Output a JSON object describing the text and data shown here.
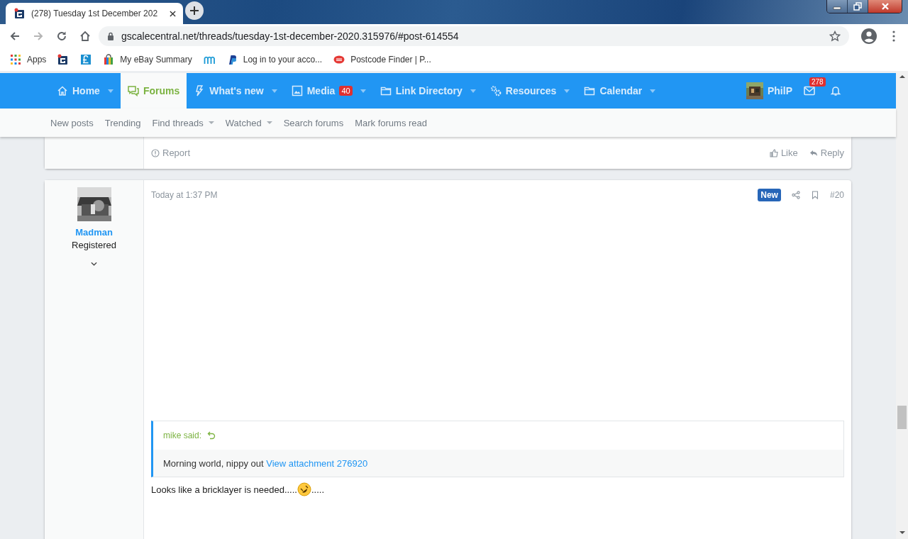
{
  "browser": {
    "tab_title": "(278) Tuesday 1st December 202",
    "url": "gscalecentral.net/threads/tuesday-1st-december-2020.315976/#post-614554",
    "bookmarks": [
      {
        "kind": "apps",
        "label": "Apps"
      },
      {
        "kind": "site"
      },
      {
        "kind": "pound"
      },
      {
        "kind": "bag",
        "label": "My eBay Summary"
      },
      {
        "kind": "m"
      },
      {
        "kind": "paypal",
        "label": "Log in to your acco..."
      },
      {
        "kind": "post",
        "label": "Postcode Finder | P..."
      }
    ]
  },
  "nav": {
    "items": [
      {
        "label": "Home",
        "selected": false,
        "menu": true
      },
      {
        "label": "Forums",
        "selected": true,
        "menu": false
      },
      {
        "label": "What's new",
        "selected": false,
        "menu": true
      },
      {
        "label": "Media",
        "badge": "40",
        "selected": false,
        "menu": true
      },
      {
        "label": "Link Directory",
        "selected": false,
        "menu": true
      },
      {
        "label": "Resources",
        "selected": false,
        "menu": true
      },
      {
        "label": "Calendar",
        "selected": false,
        "menu": true
      }
    ],
    "user": {
      "name": "PhilP",
      "messages_badge": "278"
    }
  },
  "subnav": [
    {
      "label": "New posts",
      "menu": false
    },
    {
      "label": "Trending",
      "menu": false
    },
    {
      "label": "Find threads",
      "menu": true
    },
    {
      "label": "Watched",
      "menu": true
    },
    {
      "label": "Search forums",
      "menu": false
    },
    {
      "label": "Mark forums read",
      "menu": false
    }
  ],
  "previous_post": {
    "report": "Report",
    "like": "Like",
    "reply": "Reply"
  },
  "post": {
    "author": "Madman",
    "role": "Registered",
    "time": "Today at 1:37 PM",
    "badge": "New",
    "number": "#20",
    "quote": {
      "author": "mike said:",
      "text": "Morning world, nippy out ",
      "link": "View attachment 276920"
    },
    "body_before": "Looks like a bricklayer is needed.....",
    "body_after": "....."
  }
}
